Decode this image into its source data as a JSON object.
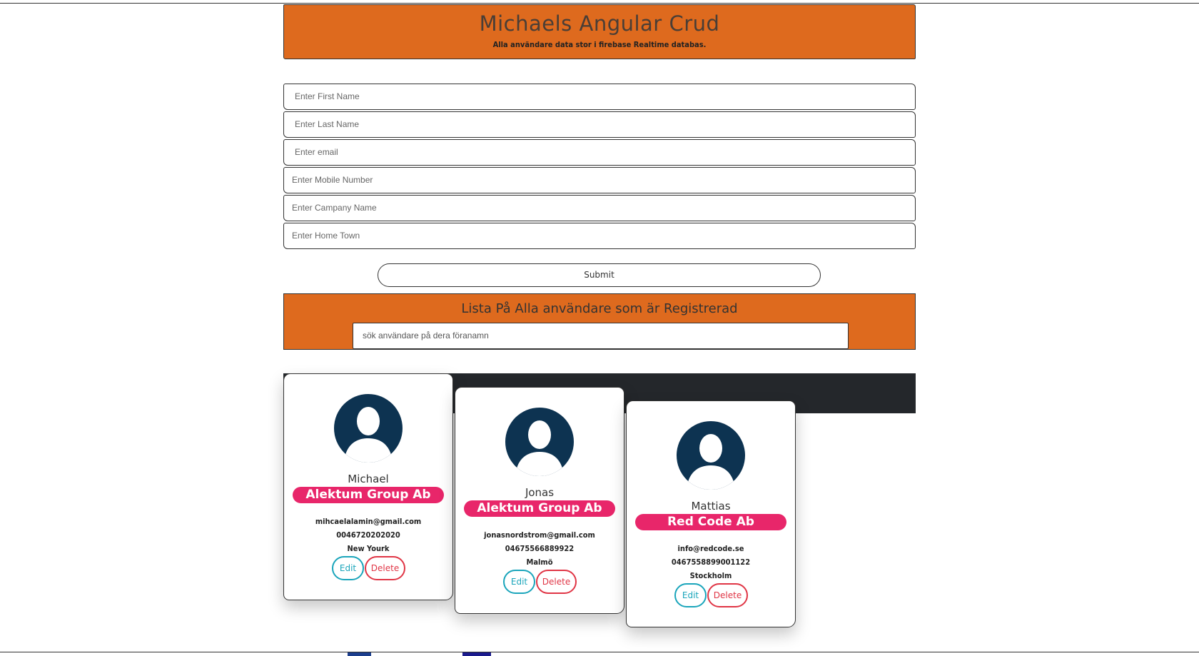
{
  "header": {
    "title": "Michaels Angular Crud",
    "subtitle": "Alla användare data stor i firebase Realtime databas."
  },
  "form": {
    "first_name_placeholder": "Enter First Name",
    "last_name_placeholder": "Enter Last Name",
    "email_placeholder": "Enter email",
    "mobile_placeholder": "Enter Mobile Number",
    "company_placeholder": "Enter Campany Name",
    "hometown_placeholder": "Enter Home Town",
    "submit_label": "Submit"
  },
  "list": {
    "heading": "Lista På Alla användare som är Registrerad",
    "search_placeholder": "sök användare på dera föranamn"
  },
  "users": [
    {
      "name": "Michael",
      "company": "Alektum Group Ab",
      "email": "mihcaelalamin@gmail.com",
      "phone": "0046720202020",
      "town": "New Yourk",
      "edit_label": "Edit",
      "delete_label": "Delete"
    },
    {
      "name": "Jonas",
      "company": "Alektum Group Ab",
      "email": "jonasnordstrom@gmail.com",
      "phone": "04675566889922",
      "town": "Malmö",
      "edit_label": "Edit",
      "delete_label": "Delete"
    },
    {
      "name": "Mattias",
      "company": "Red Code Ab",
      "email": "info@redcode.se",
      "phone": "0467558899001122",
      "town": "Stockholm",
      "edit_label": "Edit",
      "delete_label": "Delete"
    }
  ],
  "colors": {
    "accent_orange": "#de6a1e",
    "company_badge": "#e8266a",
    "avatar_bg": "#0d3351",
    "edit_color": "#1aa5bb",
    "delete_color": "#e03545"
  }
}
